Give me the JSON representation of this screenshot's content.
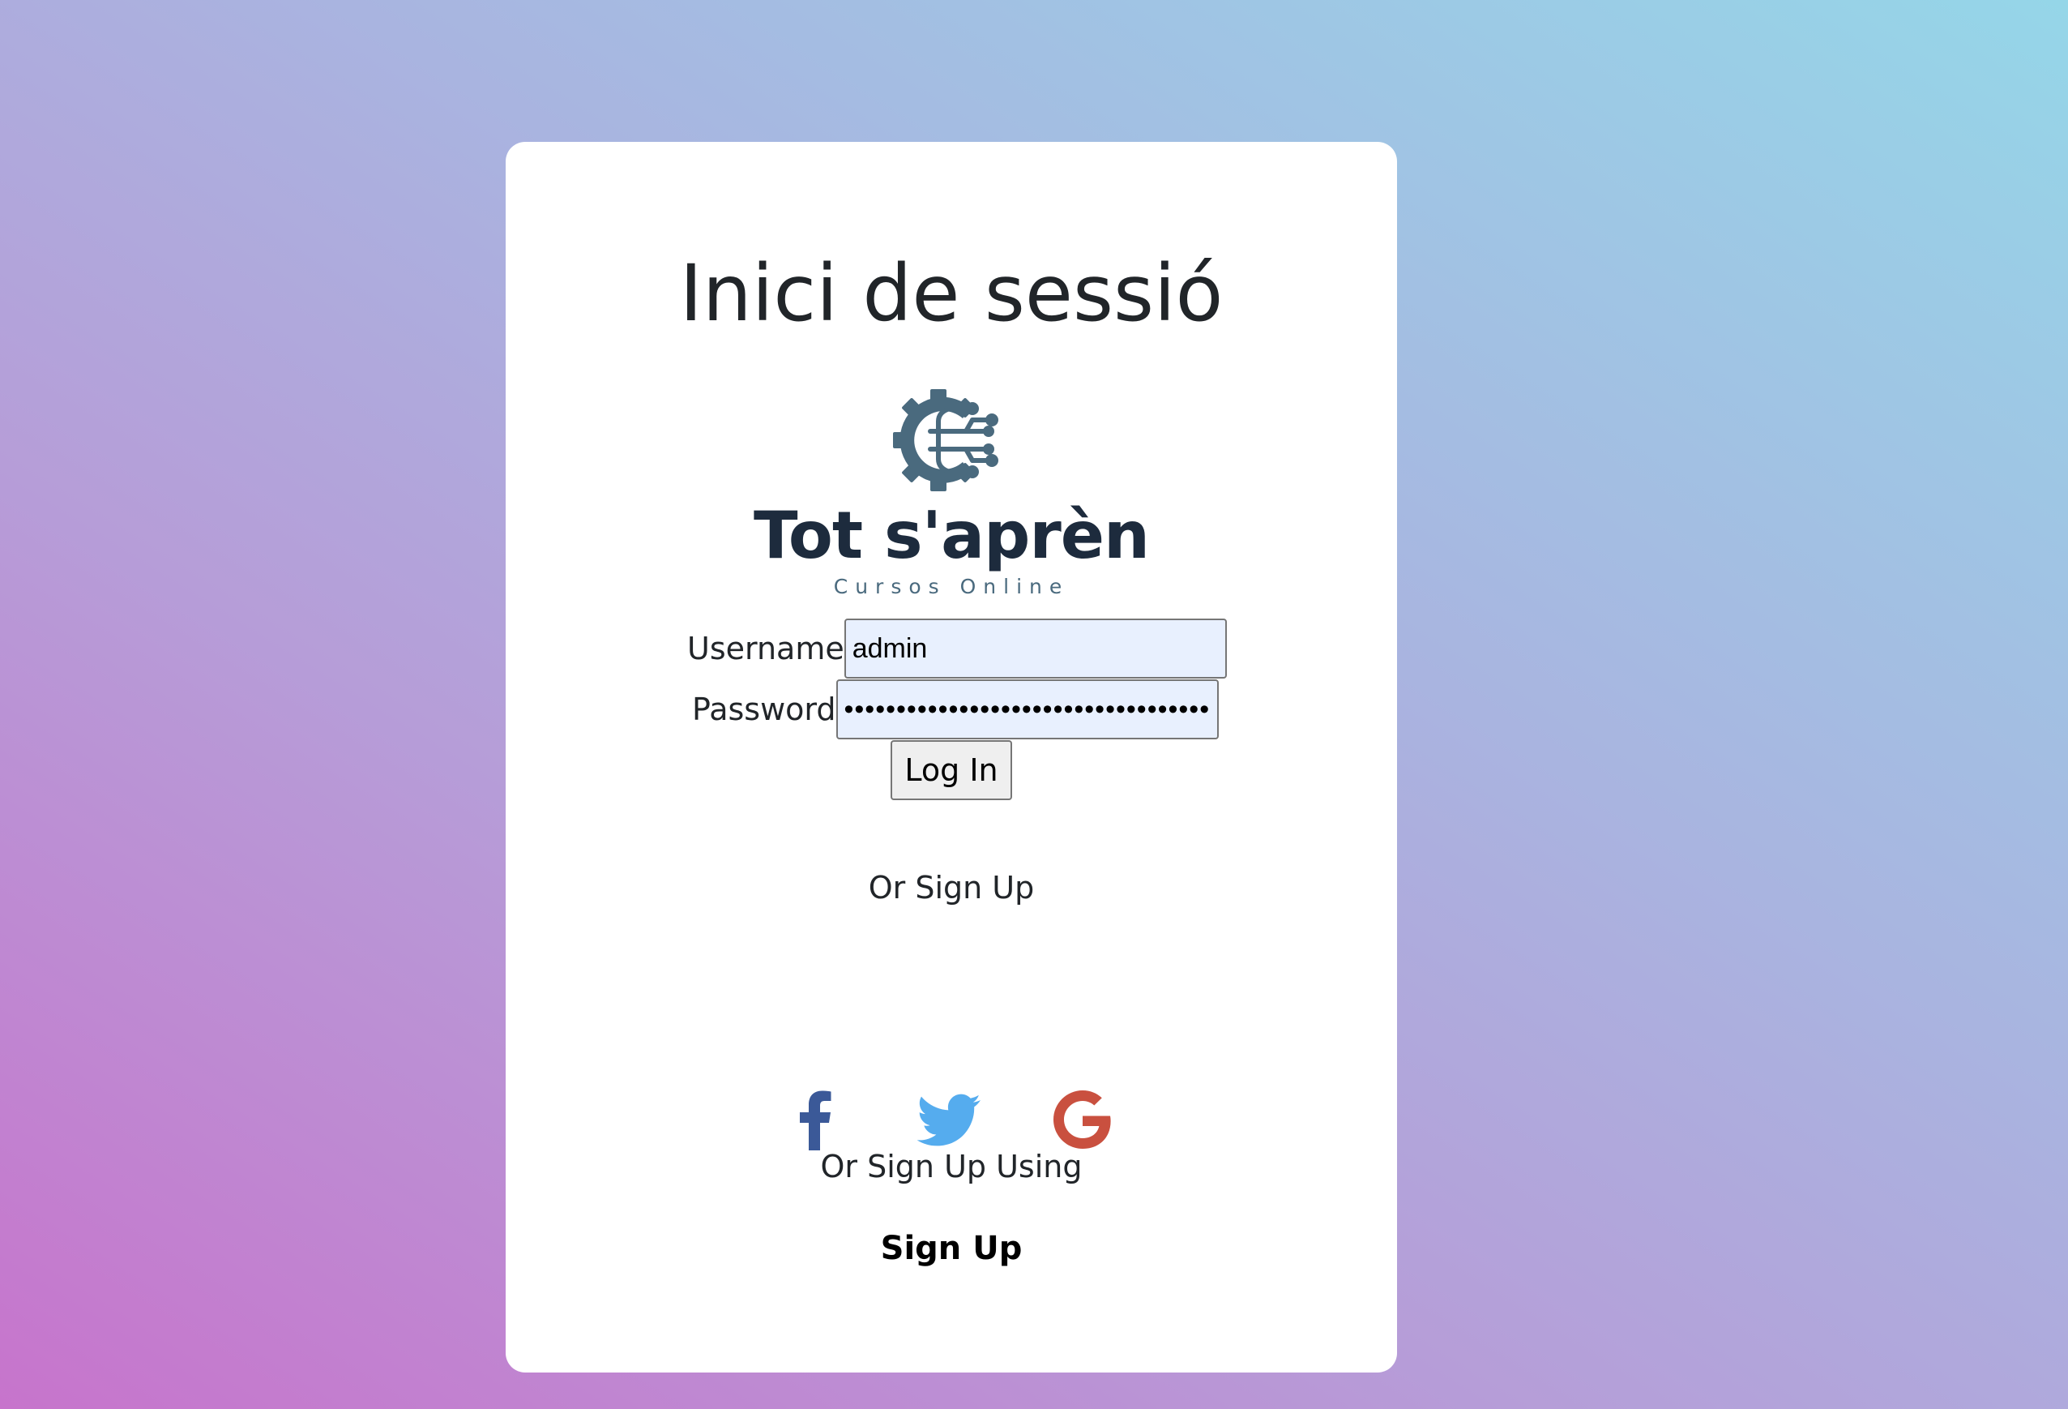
{
  "page": {
    "title": "Inici de sessió"
  },
  "brand": {
    "name": "Tot s'aprèn",
    "tagline": "Cursos Online",
    "logo_icon": "gear-circuit-icon",
    "logo_color": "#4a6a7e"
  },
  "form": {
    "username_label": "Username",
    "username_value": "admin",
    "password_label": "Password",
    "password_value": "••••••••••••••••••••••••••••••••••••••",
    "login_label": "Log In"
  },
  "signup": {
    "or_label": "Or Sign Up",
    "social": [
      {
        "name": "facebook-icon",
        "color": "#3b5998"
      },
      {
        "name": "twitter-icon",
        "color": "#55acee"
      },
      {
        "name": "google-icon",
        "color": "#c9503f"
      }
    ],
    "or_using_label": "Or Sign Up Using",
    "signup_label": "Sign Up"
  }
}
